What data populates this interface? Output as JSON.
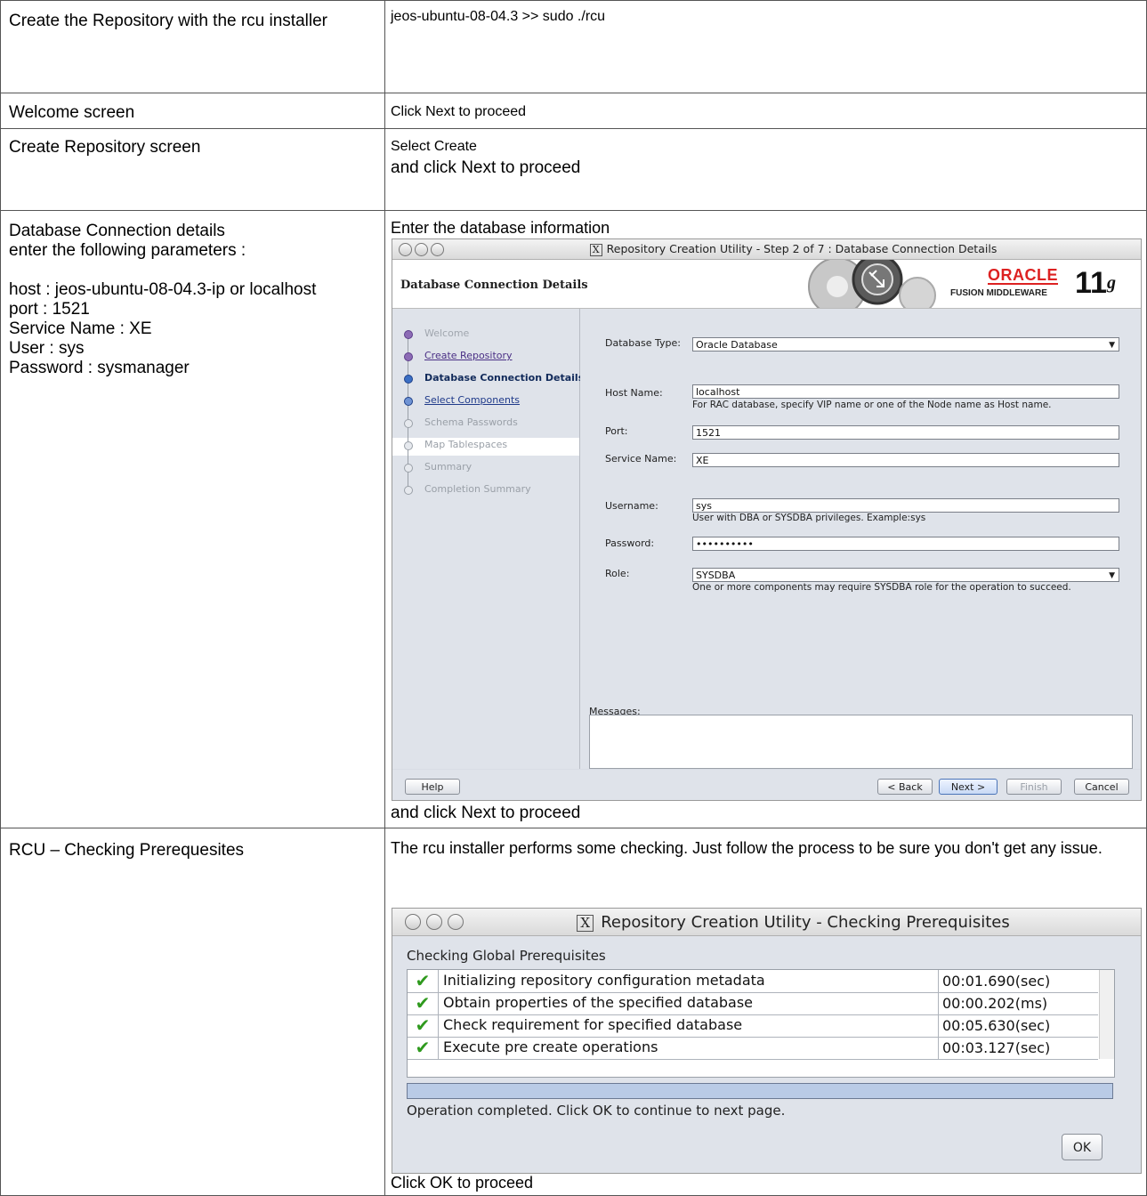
{
  "rows": [
    {
      "left": "Create the Repository with the rcu installer",
      "right": "jeos-ubuntu-08-04.3 >>  sudo ./rcu"
    },
    {
      "left": "Welcome screen",
      "right": "Click Next to proceed"
    },
    {
      "left": "Create Repository screen",
      "right_line1": "Select Create",
      "right_line2": "and click Next to proceed"
    },
    {
      "left": "Database Connection details\nenter the following parameters :\n\nhost : jeos-ubuntu-08-04.3-ip or localhost\nport : 1521\nService Name : XE\nUser : sys\nPassword : sysmanager",
      "right_top": "Enter the database information",
      "right_bottom": "and click Next to proceed"
    },
    {
      "left": "RCU – Checking Prerequesites",
      "right_top": "The rcu installer performs some checking. Just follow the process to be sure you don't get any issue.",
      "right_bottom": "Click OK to proceed"
    }
  ],
  "db_window": {
    "title": "Repository Creation Utility - Step 2 of 7 : Database Connection Details",
    "header_title": "Database Connection Details",
    "brand": {
      "oracle": "ORACLE",
      "fusion": "FUSION MIDDLEWARE",
      "version": "11",
      "version_suffix": "g"
    },
    "steps": [
      {
        "label": "Welcome",
        "state": "done"
      },
      {
        "label": "Create Repository",
        "state": "visited"
      },
      {
        "label": "Database Connection Details",
        "state": "current"
      },
      {
        "label": "Select Components",
        "state": "next"
      },
      {
        "label": "Schema Passwords",
        "state": "todo"
      },
      {
        "label": "Map Tablespaces",
        "state": "todo"
      },
      {
        "label": "Summary",
        "state": "todo"
      },
      {
        "label": "Completion Summary",
        "state": "todo"
      }
    ],
    "fields": {
      "db_type_label": "Database Type:",
      "db_type_value": "Oracle Database",
      "host_label": "Host Name:",
      "host_value": "localhost",
      "host_hint": "For RAC database, specify VIP name or one of the Node name as Host name.",
      "port_label": "Port:",
      "port_value": "1521",
      "service_label": "Service Name:",
      "service_value": "XE",
      "user_label": "Username:",
      "user_value": "sys",
      "user_hint": "User with DBA or SYSDBA privileges. Example:sys",
      "password_label": "Password:",
      "password_value": "••••••••••",
      "role_label": "Role:",
      "role_value": "SYSDBA",
      "role_hint": "One or more components may require SYSDBA role for the operation to succeed."
    },
    "messages_label": "Messages:",
    "buttons": {
      "help": "Help",
      "back": "< Back",
      "next": "Next >",
      "finish": "Finish",
      "cancel": "Cancel"
    }
  },
  "prereq_window": {
    "title": "Repository Creation Utility - Checking Prerequisites",
    "section_title": "Checking Global Prerequisites",
    "items": [
      {
        "name": "Initializing repository configuration metadata",
        "time": "00:01.690(sec)"
      },
      {
        "name": "Obtain properties of the specified database",
        "time": "00:00.202(ms)"
      },
      {
        "name": "Check requirement for specified database",
        "time": "00:05.630(sec)"
      },
      {
        "name": "Execute pre create operations",
        "time": "00:03.127(sec)"
      }
    ],
    "progress": 1.0,
    "status": "Operation completed. Click OK to continue to next page.",
    "ok_label": "OK"
  }
}
